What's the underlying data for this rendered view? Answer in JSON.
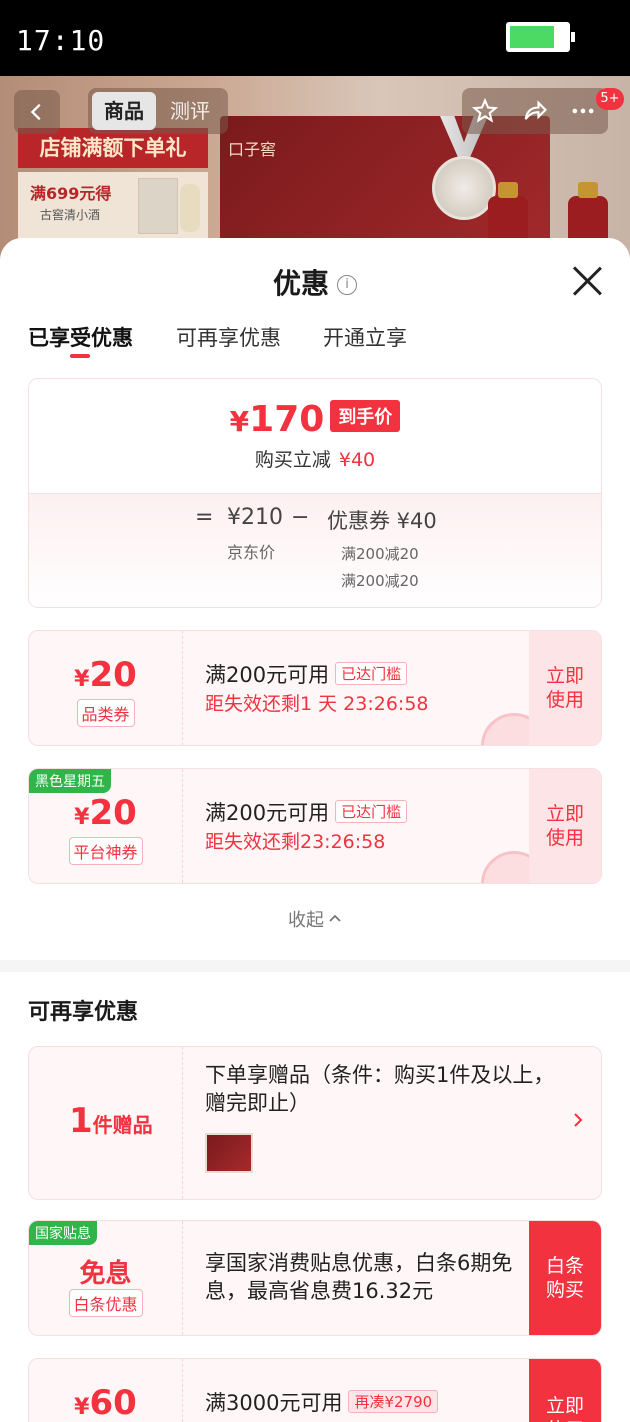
{
  "status": {
    "time": "17:10"
  },
  "header": {
    "tab_active": "商品",
    "tab_inactive": "测评",
    "badge": "5+",
    "promo_banner": "店铺满额下单礼",
    "promo_line1": "满699元得",
    "promo_line2": "古窖清小酒",
    "brand_logo": "口子窖"
  },
  "sheet": {
    "title": "优惠",
    "info_glyph": "i",
    "tabs": [
      "已享受优惠",
      "可再享优惠",
      "开通立享"
    ]
  },
  "price_card": {
    "currency": "¥",
    "final_price": "170",
    "final_tag": "到手价",
    "reduce_label": "购买立减",
    "reduce_amount": "¥40",
    "eq": "=",
    "jd_price": "¥210",
    "jd_price_label": "京东价",
    "minus": "−",
    "coupon_total": "优惠券 ¥40",
    "cond1": "满200减20",
    "cond2": "满200减20"
  },
  "coupons": [
    {
      "currency": "¥",
      "value": "20",
      "kind": "品类券",
      "condition": "满200元可用",
      "badge": "已达门槛",
      "expire": "距失效还剩1 天 23:26:58",
      "action": "立即使用",
      "ribbon": ""
    },
    {
      "currency": "¥",
      "value": "20",
      "kind": "平台神券",
      "condition": "满200元可用",
      "badge": "已达门槛",
      "expire": "距失效还剩23:26:58",
      "action": "立即使用",
      "ribbon": "黑色星期五"
    }
  ],
  "collapse_label": "收起",
  "section2_title": "可再享优惠",
  "gift": {
    "count": "1",
    "unit": "件赠品",
    "desc": "下单享赠品（条件：购买1件及以上，赠完即止）"
  },
  "loan": {
    "ribbon": "国家贴息",
    "big": "免息",
    "kind": "白条优惠",
    "desc": "享国家消费贴息优惠，白条6期免息，最高省息费16.32元",
    "action": "白条购买"
  },
  "coupon3": {
    "currency": "¥",
    "value": "60",
    "condition": "满3000元可用",
    "badge": "再凑¥2790",
    "action": "立即使用"
  },
  "colors": {
    "accent": "#f2323f",
    "green_tag": "#2fb54a"
  },
  "icons": [
    "back-arrow-icon",
    "star-icon",
    "share-icon",
    "more-icon",
    "info-icon",
    "close-icon",
    "chevron-up-icon",
    "chevron-right-icon"
  ]
}
